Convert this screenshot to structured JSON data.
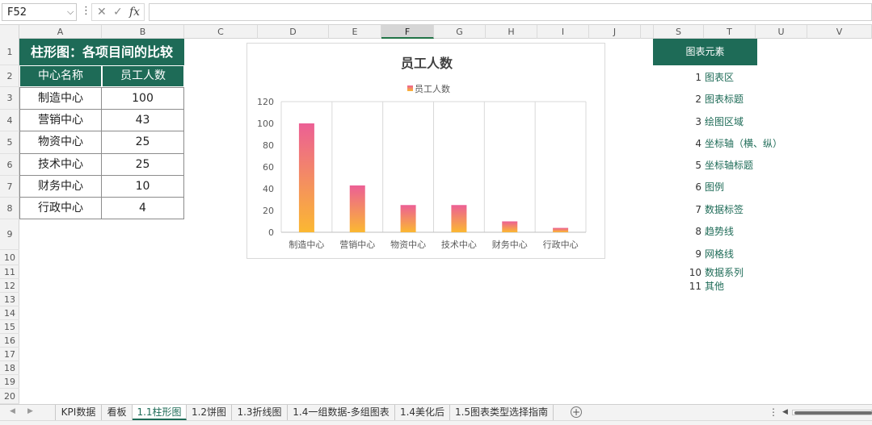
{
  "formula_bar": {
    "name_box": "F52",
    "name_box_arrow_icon": "chevron-down-icon",
    "more_icon": "vertical-dots-icon",
    "cancel_icon": "close-icon",
    "enter_icon": "check-icon",
    "fx_label": "fx",
    "formula": ""
  },
  "columns": [
    "A",
    "B",
    "C",
    "D",
    "E",
    "F",
    "G",
    "H",
    "I",
    "J",
    "",
    "S",
    "T",
    "U",
    "V"
  ],
  "selected_column": "F",
  "rows": [
    "1",
    "2",
    "3",
    "4",
    "5",
    "6",
    "7",
    "8",
    "9",
    "10",
    "11",
    "12",
    "13",
    "14",
    "15",
    "16",
    "17",
    "18",
    "19",
    "20"
  ],
  "table": {
    "title": "柱形图：各项目间的比较",
    "headers": [
      "中心名称",
      "员工人数"
    ],
    "rows": [
      {
        "name": "制造中心",
        "value": "100"
      },
      {
        "name": "营销中心",
        "value": "43"
      },
      {
        "name": "物资中心",
        "value": "25"
      },
      {
        "name": "技术中心",
        "value": "25"
      },
      {
        "name": "财务中心",
        "value": "10"
      },
      {
        "name": "行政中心",
        "value": "4"
      }
    ]
  },
  "chart_data": {
    "type": "bar",
    "title": "员工人数",
    "categories": [
      "制造中心",
      "营销中心",
      "物资中心",
      "技术中心",
      "财务中心",
      "行政中心"
    ],
    "series": [
      {
        "name": "员工人数",
        "values": [
          100,
          43,
          25,
          25,
          10,
          4
        ]
      }
    ],
    "ylim": [
      0,
      120
    ],
    "yticks": [
      "0",
      "20",
      "40",
      "60",
      "80",
      "100",
      "120"
    ],
    "grid": "vertical",
    "legend": "top",
    "gradient_colors": [
      "#ec5f95",
      "#fbb832"
    ]
  },
  "elements_panel": {
    "header": "图表元素",
    "items": [
      {
        "num": "1",
        "label": "图表区"
      },
      {
        "num": "2",
        "label": "图表标题"
      },
      {
        "num": "3",
        "label": "绘图区域"
      },
      {
        "num": "4",
        "label": "坐标轴（横、纵）"
      },
      {
        "num": "5",
        "label": "坐标轴标题"
      },
      {
        "num": "6",
        "label": "图例"
      },
      {
        "num": "7",
        "label": "数据标签"
      },
      {
        "num": "8",
        "label": "趋势线"
      },
      {
        "num": "9",
        "label": "网格线"
      },
      {
        "num": "10",
        "label": "数据系列"
      },
      {
        "num": "11",
        "label": "其他"
      }
    ]
  },
  "sheet_tabs": [
    "KPI数据",
    "看板",
    "1.1柱形图",
    "1.2饼图",
    "1.3折线图",
    "1.4一组数据-多组图表",
    "1.4美化后",
    "1.5图表类型选择指南"
  ],
  "active_tab": "1.1柱形图",
  "add_sheet_icon": "plus-circle-icon",
  "colors": {
    "accent": "#1e6b57",
    "grid_header": "#f2f2f2"
  }
}
